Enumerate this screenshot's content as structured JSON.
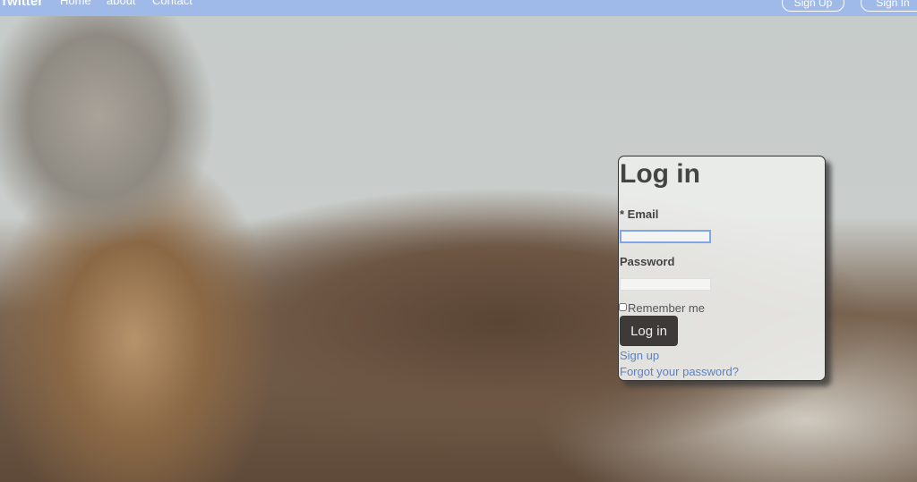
{
  "nav": {
    "brand": "Twitter",
    "links": [
      "Home",
      "about",
      "Contact"
    ],
    "sign_up": "Sign Up",
    "sign_in": "Sign In"
  },
  "login": {
    "title": "Log in",
    "email_label": "* Email",
    "email_value": "",
    "password_label": "Password",
    "password_value": "",
    "remember_label": "Remember me",
    "remember_checked": false,
    "submit": "Log in",
    "sign_up_link": "Sign up",
    "forgot_link": "Forgot your password?"
  },
  "colors": {
    "navbar": "#9fb9e8",
    "button": "#3d3a38",
    "link": "#5a82c9"
  }
}
